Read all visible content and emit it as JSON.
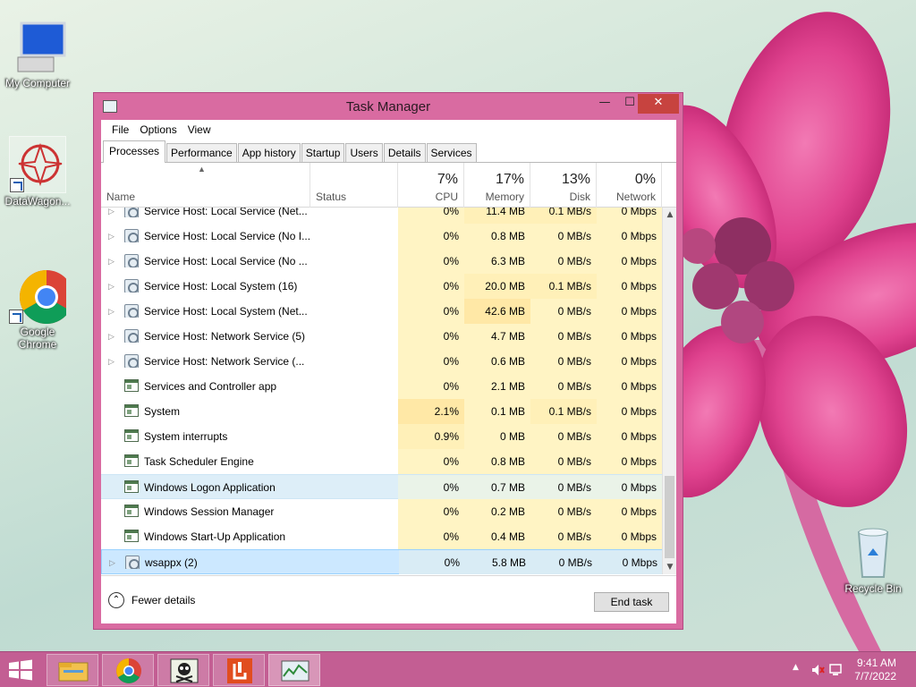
{
  "desktop": {
    "icons": [
      {
        "label": "My Computer",
        "icon": "computer-icon"
      },
      {
        "label": "DataWagon...",
        "icon": "datawagon-icon"
      },
      {
        "label": "Google Chrome",
        "icon": "chrome-icon"
      },
      {
        "label": "Recycle Bin",
        "icon": "recycle-bin-icon"
      }
    ]
  },
  "window": {
    "title": "Task Manager",
    "minimize": "—",
    "maximize": "☐",
    "close": "✕"
  },
  "menu": [
    "File",
    "Options",
    "View"
  ],
  "tabs": [
    "Processes",
    "Performance",
    "App history",
    "Startup",
    "Users",
    "Details",
    "Services"
  ],
  "active_tab": "Processes",
  "columns": {
    "name": "Name",
    "status": "Status",
    "cpu": {
      "label": "CPU",
      "pct": "7%"
    },
    "memory": {
      "label": "Memory",
      "pct": "17%"
    },
    "disk": {
      "label": "Disk",
      "pct": "13%"
    },
    "network": {
      "label": "Network",
      "pct": "0%"
    }
  },
  "rows": [
    {
      "expand": "▷",
      "icon": "service",
      "name": "Service Host: Local Service (Net...",
      "cpu": "0%",
      "mem": "11.4 MB",
      "disk": "0.1 MB/s",
      "net": "0 Mbps"
    },
    {
      "expand": "▷",
      "icon": "service",
      "name": "Service Host: Local Service (No I...",
      "cpu": "0%",
      "mem": "0.8 MB",
      "disk": "0 MB/s",
      "net": "0 Mbps"
    },
    {
      "expand": "▷",
      "icon": "service",
      "name": "Service Host: Local Service (No ...",
      "cpu": "0%",
      "mem": "6.3 MB",
      "disk": "0 MB/s",
      "net": "0 Mbps"
    },
    {
      "expand": "▷",
      "icon": "service",
      "name": "Service Host: Local System (16)",
      "cpu": "0%",
      "mem": "20.0 MB",
      "disk": "0.1 MB/s",
      "net": "0 Mbps"
    },
    {
      "expand": "▷",
      "icon": "service",
      "name": "Service Host: Local System (Net...",
      "cpu": "0%",
      "mem": "42.6 MB",
      "disk": "0 MB/s",
      "net": "0 Mbps"
    },
    {
      "expand": "▷",
      "icon": "service",
      "name": "Service Host: Network Service (5)",
      "cpu": "0%",
      "mem": "4.7 MB",
      "disk": "0 MB/s",
      "net": "0 Mbps"
    },
    {
      "expand": "▷",
      "icon": "service",
      "name": "Service Host: Network Service (...",
      "cpu": "0%",
      "mem": "0.6 MB",
      "disk": "0 MB/s",
      "net": "0 Mbps"
    },
    {
      "expand": "",
      "icon": "app",
      "name": "Services and Controller app",
      "cpu": "0%",
      "mem": "2.1 MB",
      "disk": "0 MB/s",
      "net": "0 Mbps"
    },
    {
      "expand": "",
      "icon": "app",
      "name": "System",
      "cpu": "2.1%",
      "mem": "0.1 MB",
      "disk": "0.1 MB/s",
      "net": "0 Mbps"
    },
    {
      "expand": "",
      "icon": "app",
      "name": "System interrupts",
      "cpu": "0.9%",
      "mem": "0 MB",
      "disk": "0 MB/s",
      "net": "0 Mbps"
    },
    {
      "expand": "",
      "icon": "app",
      "name": "Task Scheduler Engine",
      "cpu": "0%",
      "mem": "0.8 MB",
      "disk": "0 MB/s",
      "net": "0 Mbps"
    },
    {
      "expand": "",
      "icon": "app",
      "name": "Windows Logon Application",
      "cpu": "0%",
      "mem": "0.7 MB",
      "disk": "0 MB/s",
      "net": "0 Mbps"
    },
    {
      "expand": "",
      "icon": "app",
      "name": "Windows Session Manager",
      "cpu": "0%",
      "mem": "0.2 MB",
      "disk": "0 MB/s",
      "net": "0 Mbps"
    },
    {
      "expand": "",
      "icon": "app",
      "name": "Windows Start-Up Application",
      "cpu": "0%",
      "mem": "0.4 MB",
      "disk": "0 MB/s",
      "net": "0 Mbps"
    },
    {
      "expand": "▷",
      "icon": "service",
      "name": "wsappx (2)",
      "cpu": "0%",
      "mem": "5.8 MB",
      "disk": "0 MB/s",
      "net": "0 Mbps"
    }
  ],
  "footer": {
    "fewer_details": "Fewer details",
    "end_task": "End task"
  },
  "taskbar": {
    "apps": [
      "file-explorer-icon",
      "chrome-icon",
      "pirate-app-icon",
      "office-app-icon",
      "task-manager-icon"
    ],
    "clock_time": "9:41 AM",
    "clock_date": "7/7/2022"
  }
}
